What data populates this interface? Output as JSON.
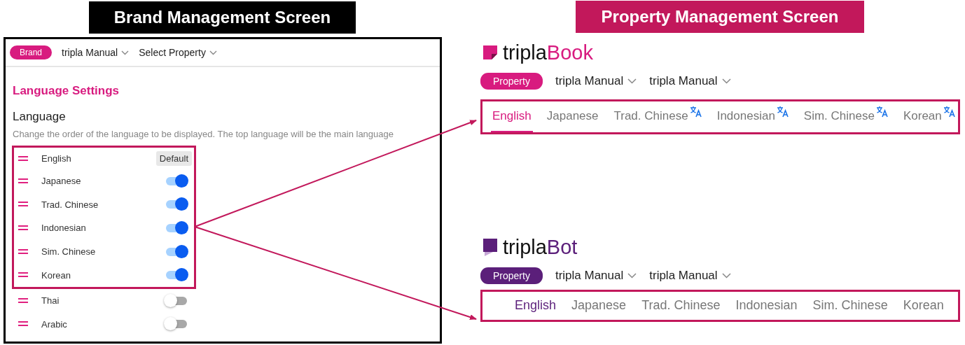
{
  "annotations": {
    "left_title": "Brand Management Screen",
    "right_title": "Property Management Screen"
  },
  "brand_screen": {
    "badge": "Brand",
    "selectors": [
      "tripla Manual",
      "Select Property"
    ],
    "section_title": "Language Settings",
    "heading": "Language",
    "description": "Change the order of the language to be displayed. The top language will be the main language",
    "languages": [
      {
        "name": "English",
        "kind": "default",
        "label": "Default",
        "highlighted": true
      },
      {
        "name": "Japanese",
        "kind": "toggle",
        "on": true,
        "highlighted": true
      },
      {
        "name": "Trad. Chinese",
        "kind": "toggle",
        "on": true,
        "highlighted": true
      },
      {
        "name": "Indonesian",
        "kind": "toggle",
        "on": true,
        "highlighted": true
      },
      {
        "name": "Sim. Chinese",
        "kind": "toggle",
        "on": true,
        "highlighted": true
      },
      {
        "name": "Korean",
        "kind": "toggle",
        "on": true,
        "highlighted": true
      },
      {
        "name": "Thai",
        "kind": "toggle",
        "on": false,
        "highlighted": false
      },
      {
        "name": "Arabic",
        "kind": "toggle",
        "on": false,
        "highlighted": false
      }
    ]
  },
  "property_screens": [
    {
      "kind": "book",
      "logo": {
        "prefix": "tripla",
        "suffix": "Book"
      },
      "badge": "Property",
      "selectors": [
        "tripla Manual",
        "tripla Manual"
      ],
      "tabs": [
        {
          "label": "English",
          "selected": true,
          "translated": false
        },
        {
          "label": "Japanese",
          "selected": false,
          "translated": false
        },
        {
          "label": "Trad. Chinese",
          "selected": false,
          "translated": true
        },
        {
          "label": "Indonesian",
          "selected": false,
          "translated": true
        },
        {
          "label": "Sim. Chinese",
          "selected": false,
          "translated": true
        },
        {
          "label": "Korean",
          "selected": false,
          "translated": true
        }
      ]
    },
    {
      "kind": "bot",
      "logo": {
        "prefix": "tripla",
        "suffix": "Bot"
      },
      "badge": "Property",
      "selectors": [
        "tripla Manual",
        "tripla Manual"
      ],
      "tabs": [
        {
          "label": "English",
          "selected": true,
          "translated": false
        },
        {
          "label": "Japanese",
          "selected": false,
          "translated": false
        },
        {
          "label": "Trad. Chinese",
          "selected": false,
          "translated": false
        },
        {
          "label": "Indonesian",
          "selected": false,
          "translated": false
        },
        {
          "label": "Sim. Chinese",
          "selected": false,
          "translated": false
        },
        {
          "label": "Korean",
          "selected": false,
          "translated": false
        }
      ]
    }
  ]
}
